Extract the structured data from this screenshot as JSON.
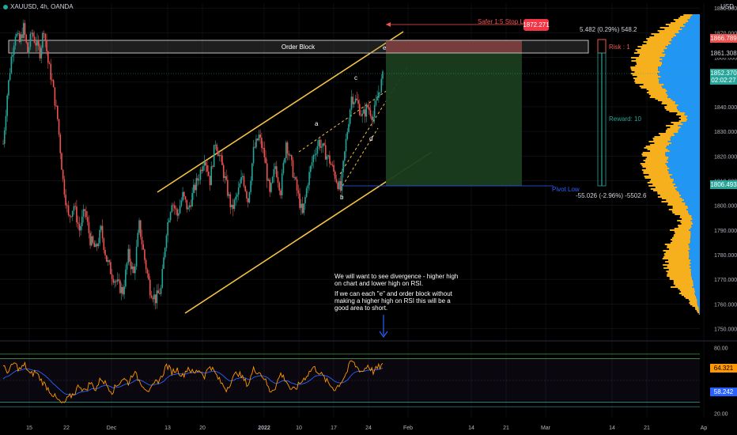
{
  "symbol": "XAUUSD, 4h, OANDA",
  "currency": "USD",
  "annotations": {
    "order_block": "Order Block",
    "safer_stop": "Safer 1:5 Stop Loss",
    "safer_stop_price": "1872.271",
    "stop_stats": "5.482 (0.29%) 548.2",
    "risk": "Risk : 1",
    "reward": "Reward: 10",
    "pivot_low": "Pivot Low",
    "target_stats": "-55.026 (-2.96%) -5502.6",
    "note_line1": "We will want to see divergence - higher high",
    "note_line2": "on chart and lower high on RSI.",
    "note_line3": "If we can each \"e\" and order block without",
    "note_line4": "making a higher high on RSI this will be a",
    "note_line5": "good area to short.",
    "wave_a": "a",
    "wave_b": "b",
    "wave_c": "c",
    "wave_d": "d",
    "wave_e": "e"
  },
  "price_labels": {
    "current": "1852.370",
    "countdown": "02:02:27",
    "upper": "1866.789",
    "ob_price": "1861.308",
    "lower": "1806.493",
    "rsi_value": "64.321",
    "rsi_ma": "58.242"
  },
  "colors": {
    "up": "#26a69a",
    "down": "#ef5350",
    "channel": "#f6c343",
    "profit": "#1b3d1f",
    "loss": "#7d2a2a",
    "rsi": "#ff9800",
    "rsi_ma": "#2962ff",
    "vp_yellow": "#f6b01e",
    "vp_blue": "#2196f3",
    "axis_text": "#b2b5be"
  },
  "chart_data": {
    "type": "candlestick",
    "title": "XAUUSD, 4h, OANDA",
    "x_ticks": [
      "15",
      "22",
      "Dec",
      "13",
      "20",
      "2022",
      "10",
      "17",
      "24",
      "Feb",
      "14",
      "21",
      "Mar",
      "14",
      "21",
      "Ap"
    ],
    "y_ticks": [
      1880,
      1870,
      1860,
      1850,
      1840,
      1830,
      1820,
      1810,
      1800,
      1790,
      1780,
      1770,
      1760,
      1750
    ],
    "ylim": [
      1746,
      1882
    ],
    "rsi_ticks": [
      80,
      20
    ],
    "rsi_ylim": [
      16,
      84
    ],
    "rsi_bands": [
      70,
      30
    ],
    "highlighted_prices": {
      "current": 1852.37,
      "upper": 1866.789,
      "ob": 1861.308,
      "lower": 1806.493
    },
    "price_path": [
      [
        0,
        1825
      ],
      [
        3,
        1845
      ],
      [
        6,
        1860
      ],
      [
        9,
        1870
      ],
      [
        12,
        1866
      ],
      [
        15,
        1872
      ],
      [
        18,
        1862
      ],
      [
        21,
        1870
      ],
      [
        24,
        1866
      ],
      [
        27,
        1862
      ],
      [
        30,
        1872
      ],
      [
        33,
        1858
      ],
      [
        36,
        1850
      ],
      [
        40,
        1835
      ],
      [
        44,
        1810
      ],
      [
        48,
        1795
      ],
      [
        52,
        1800
      ],
      [
        56,
        1790
      ],
      [
        60,
        1798
      ],
      [
        64,
        1786
      ],
      [
        68,
        1782
      ],
      [
        72,
        1790
      ],
      [
        76,
        1778
      ],
      [
        80,
        1772
      ],
      [
        84,
        1768
      ],
      [
        88,
        1765
      ],
      [
        92,
        1780
      ],
      [
        96,
        1772
      ],
      [
        100,
        1792
      ],
      [
        104,
        1778
      ],
      [
        108,
        1766
      ],
      [
        112,
        1762
      ],
      [
        116,
        1766
      ],
      [
        120,
        1790
      ],
      [
        124,
        1802
      ],
      [
        128,
        1796
      ],
      [
        132,
        1804
      ],
      [
        136,
        1798
      ],
      [
        140,
        1806
      ],
      [
        144,
        1812
      ],
      [
        148,
        1820
      ],
      [
        152,
        1810
      ],
      [
        156,
        1826
      ],
      [
        160,
        1818
      ],
      [
        164,
        1808
      ],
      [
        168,
        1798
      ],
      [
        172,
        1804
      ],
      [
        176,
        1812
      ],
      [
        180,
        1802
      ],
      [
        184,
        1822
      ],
      [
        188,
        1828
      ],
      [
        192,
        1820
      ],
      [
        196,
        1804
      ],
      [
        200,
        1816
      ],
      [
        204,
        1806
      ],
      [
        208,
        1826
      ],
      [
        212,
        1816
      ],
      [
        216,
        1806
      ],
      [
        220,
        1796
      ],
      [
        224,
        1810
      ],
      [
        228,
        1820
      ],
      [
        232,
        1826
      ],
      [
        236,
        1822
      ],
      [
        240,
        1818
      ],
      [
        244,
        1812
      ],
      [
        248,
        1806
      ],
      [
        252,
        1826
      ],
      [
        256,
        1844
      ],
      [
        260,
        1842
      ],
      [
        264,
        1836
      ],
      [
        268,
        1840
      ],
      [
        272,
        1836
      ],
      [
        276,
        1846
      ],
      [
        279,
        1852
      ]
    ],
    "rsi_path": [
      [
        0,
        62
      ],
      [
        4,
        58
      ],
      [
        8,
        66
      ],
      [
        12,
        60
      ],
      [
        16,
        64
      ],
      [
        20,
        55
      ],
      [
        24,
        58
      ],
      [
        28,
        50
      ],
      [
        32,
        44
      ],
      [
        36,
        38
      ],
      [
        40,
        32
      ],
      [
        44,
        28
      ],
      [
        48,
        34
      ],
      [
        52,
        38
      ],
      [
        56,
        46
      ],
      [
        60,
        40
      ],
      [
        64,
        48
      ],
      [
        68,
        42
      ],
      [
        72,
        52
      ],
      [
        76,
        46
      ],
      [
        80,
        40
      ],
      [
        84,
        46
      ],
      [
        88,
        52
      ],
      [
        92,
        48
      ],
      [
        96,
        58
      ],
      [
        100,
        50
      ],
      [
        104,
        44
      ],
      [
        108,
        40
      ],
      [
        112,
        48
      ],
      [
        116,
        52
      ],
      [
        120,
        64
      ],
      [
        124,
        58
      ],
      [
        128,
        60
      ],
      [
        132,
        54
      ],
      [
        136,
        62
      ],
      [
        140,
        56
      ],
      [
        144,
        60
      ],
      [
        148,
        54
      ],
      [
        152,
        64
      ],
      [
        156,
        56
      ],
      [
        160,
        48
      ],
      [
        164,
        42
      ],
      [
        168,
        50
      ],
      [
        172,
        58
      ],
      [
        176,
        52
      ],
      [
        180,
        46
      ],
      [
        184,
        60
      ],
      [
        188,
        58
      ],
      [
        192,
        52
      ],
      [
        196,
        40
      ],
      [
        200,
        44
      ],
      [
        204,
        56
      ],
      [
        208,
        50
      ],
      [
        212,
        40
      ],
      [
        216,
        44
      ],
      [
        220,
        50
      ],
      [
        224,
        56
      ],
      [
        228,
        62
      ],
      [
        232,
        58
      ],
      [
        236,
        52
      ],
      [
        240,
        46
      ],
      [
        244,
        42
      ],
      [
        248,
        48
      ],
      [
        252,
        56
      ],
      [
        256,
        68
      ],
      [
        260,
        62
      ],
      [
        264,
        58
      ],
      [
        268,
        64
      ],
      [
        272,
        58
      ],
      [
        276,
        62
      ],
      [
        279,
        64
      ]
    ]
  }
}
